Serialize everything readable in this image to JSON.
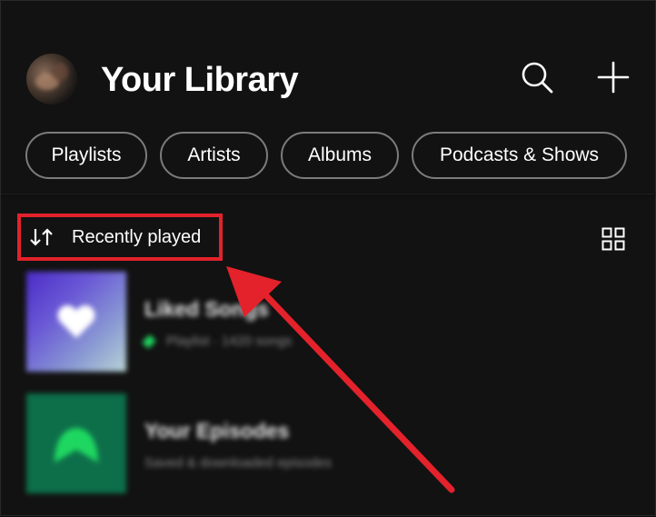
{
  "header": {
    "title": "Your Library",
    "avatar_icon": "user-avatar",
    "search_icon": "search-icon",
    "add_icon": "plus-icon"
  },
  "filters": [
    {
      "label": "Playlists"
    },
    {
      "label": "Artists"
    },
    {
      "label": "Albums"
    },
    {
      "label": "Podcasts & Shows"
    }
  ],
  "sort": {
    "label": "Recently played",
    "icon": "sort-arrows-icon",
    "highlight_color": "#e3222b"
  },
  "view_toggle_icon": "grid-view-icon",
  "items": [
    {
      "title": "Liked Songs",
      "subtitle": "Playlist · 1420 songs",
      "pinned": true,
      "cover_icon": "heart-icon"
    },
    {
      "title": "Your Episodes",
      "subtitle": "Saved & downloaded episodes",
      "pinned": false,
      "cover_icon": "bookmark-icon"
    }
  ],
  "colors": {
    "background": "#121212",
    "accent_green": "#1ed760",
    "annotation_red": "#e3222b"
  }
}
